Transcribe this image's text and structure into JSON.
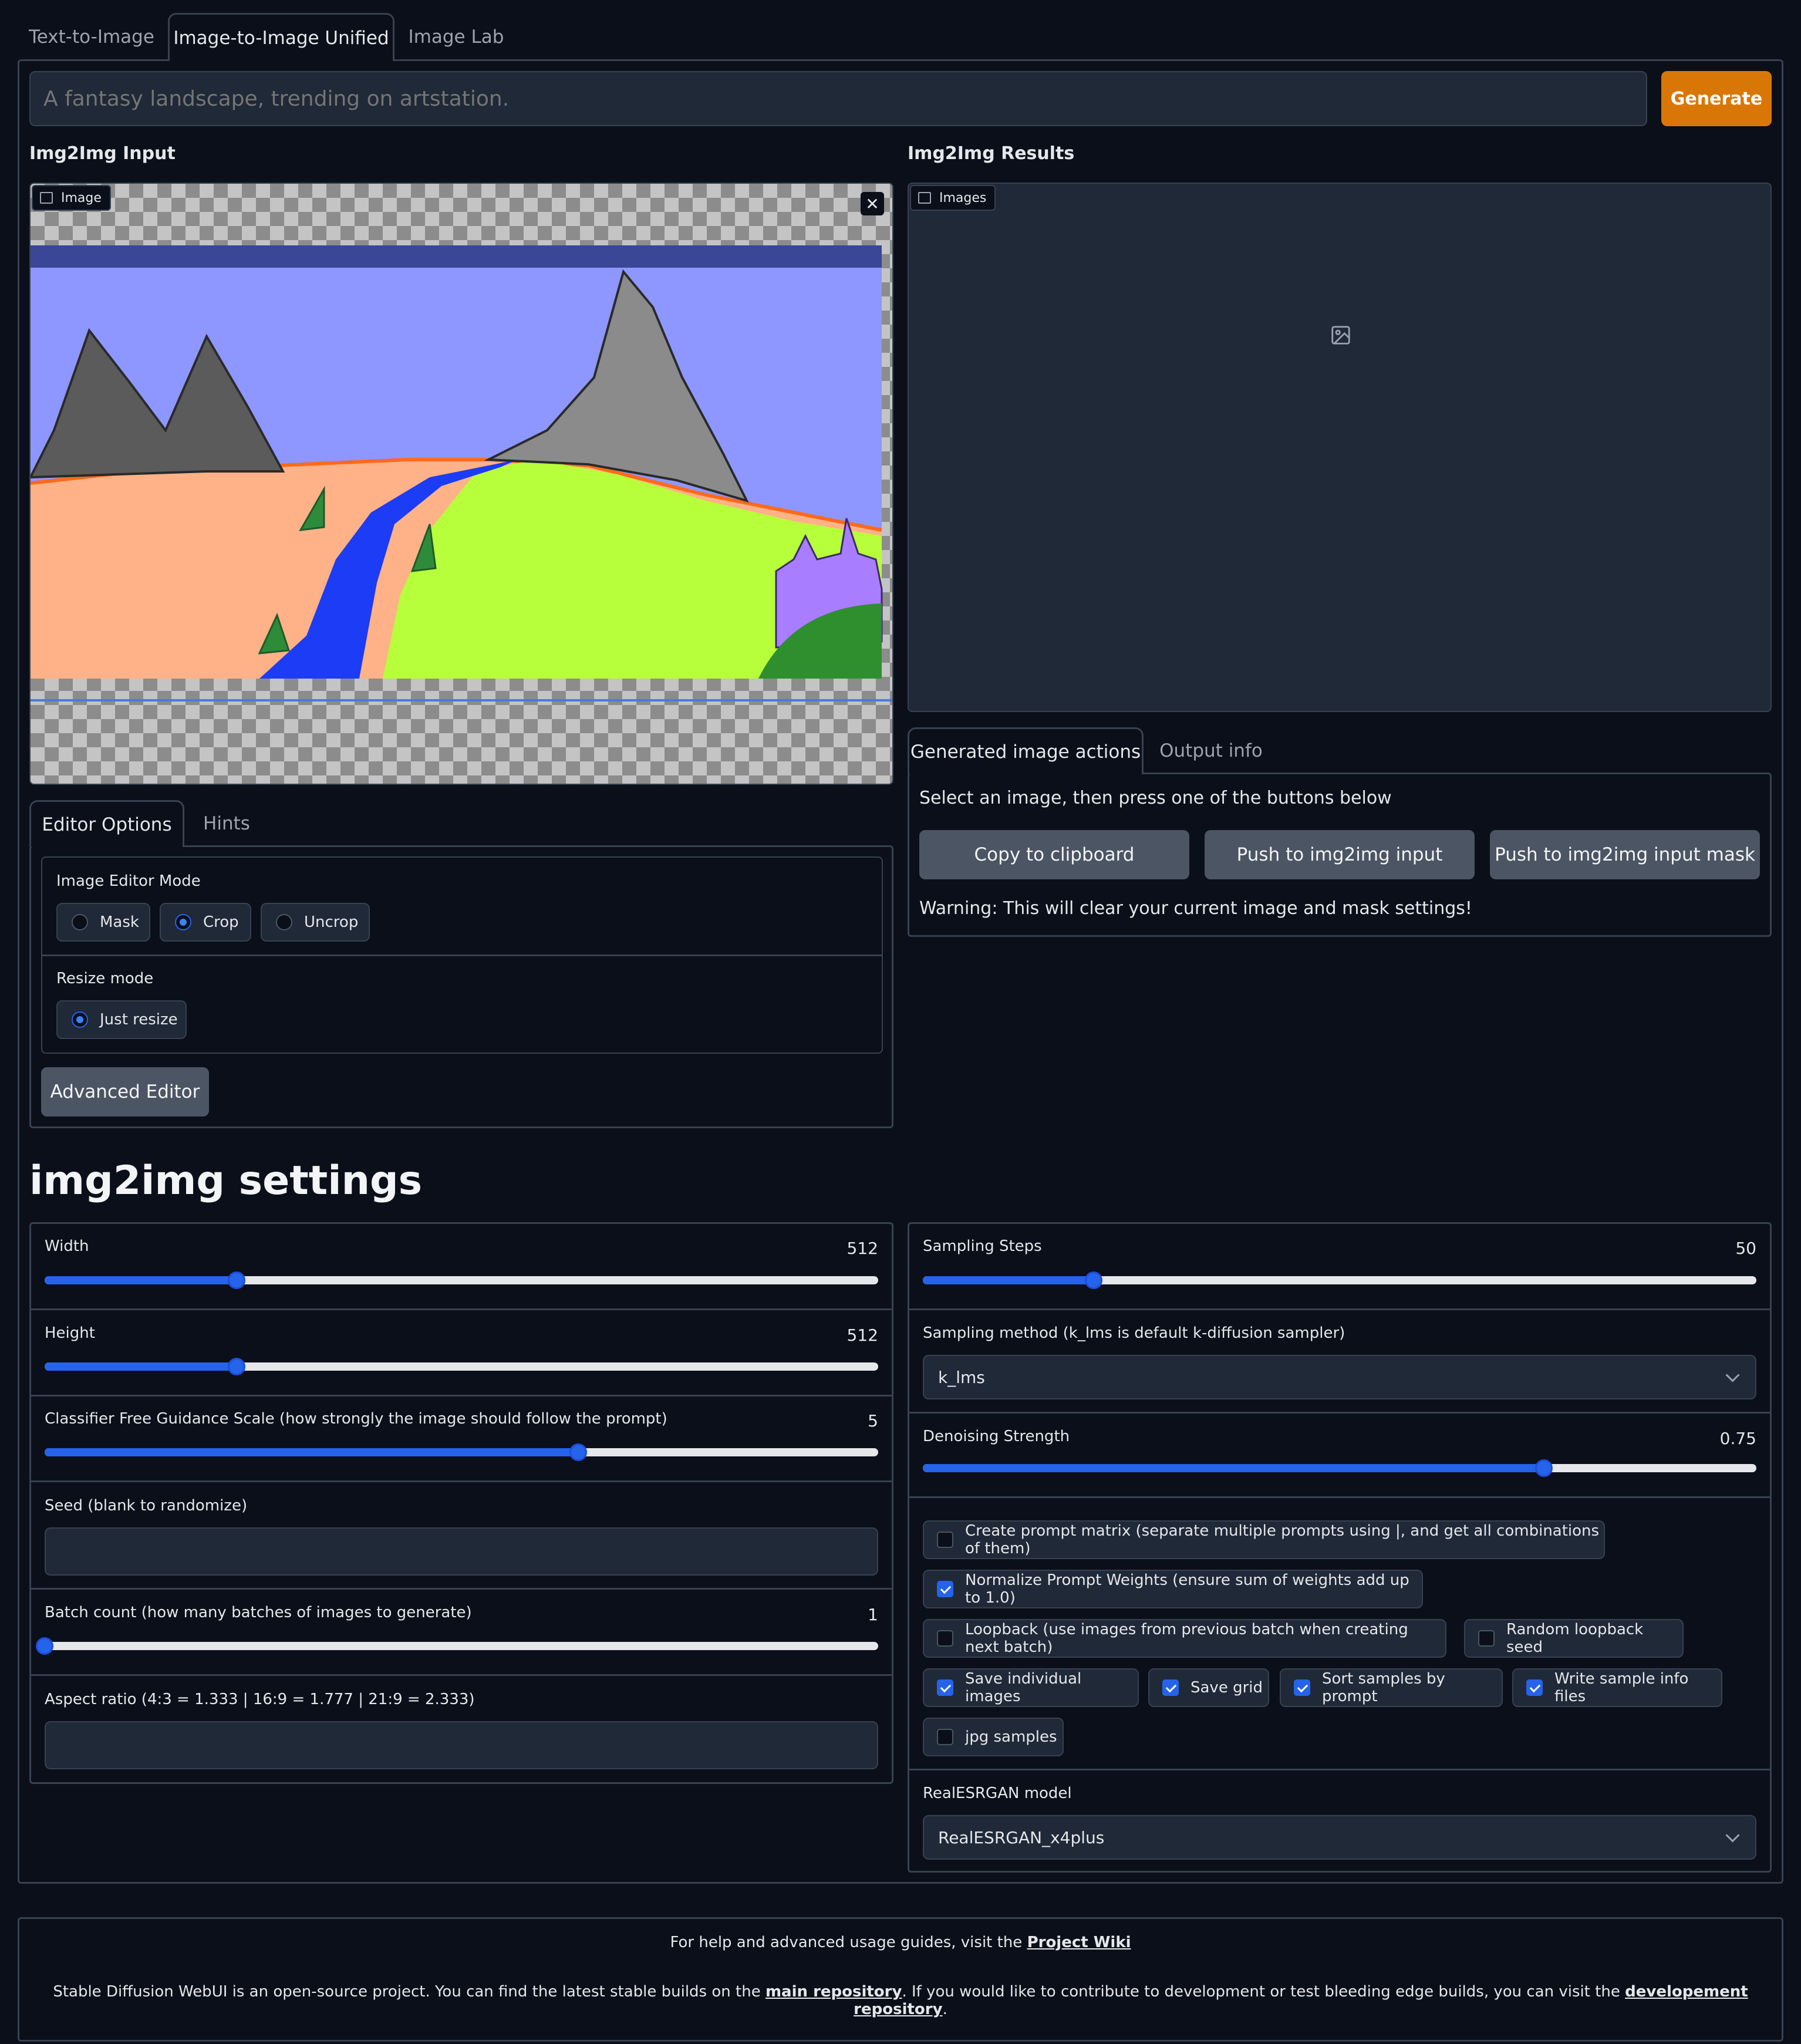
{
  "tabs": [
    {
      "label": "Text-to-Image"
    },
    {
      "label": "Image-to-Image Unified"
    },
    {
      "label": "Image Lab"
    }
  ],
  "prompt": {
    "placeholder": "A fantasy landscape, trending on artstation.",
    "value": ""
  },
  "generate_label": "Generate",
  "input_section": {
    "title": "Img2Img Input",
    "image_badge": "Image",
    "editor_tabs": [
      {
        "label": "Editor Options"
      },
      {
        "label": "Hints"
      }
    ],
    "editor_mode_label": "Image Editor Mode",
    "editor_modes": [
      {
        "label": "Mask",
        "selected": false
      },
      {
        "label": "Crop",
        "selected": true
      },
      {
        "label": "Uncrop",
        "selected": false
      }
    ],
    "resize_mode_label": "Resize mode",
    "resize_modes": [
      {
        "label": "Just resize",
        "selected": true
      }
    ],
    "advanced_editor_label": "Advanced Editor"
  },
  "results_section": {
    "title": "Img2Img Results",
    "images_badge": "Images",
    "action_tabs": [
      {
        "label": "Generated image actions"
      },
      {
        "label": "Output info"
      }
    ],
    "instruction": "Select an image, then press one of the buttons below",
    "buttons": [
      {
        "label": "Copy to clipboard"
      },
      {
        "label": "Push to img2img input"
      },
      {
        "label": "Push to img2img input mask"
      }
    ],
    "warning": "Warning: This will clear your current image and mask settings!"
  },
  "settings": {
    "title": "img2img settings",
    "width": {
      "label": "Width",
      "value": "512",
      "fraction": 0.23
    },
    "height": {
      "label": "Height",
      "value": "512",
      "fraction": 0.23
    },
    "cfg": {
      "label": "Classifier Free Guidance Scale (how strongly the image should follow the prompt)",
      "value": "5",
      "fraction": 0.64
    },
    "seed": {
      "label": "Seed (blank to randomize)",
      "value": ""
    },
    "batch_count": {
      "label": "Batch count (how many batches of images to generate)",
      "value": "1",
      "fraction": 0.0
    },
    "aspect_ratio": {
      "label": "Aspect ratio (4:3 = 1.333 | 16:9 = 1.777 | 21:9 = 2.333)",
      "value": ""
    },
    "sampling_steps": {
      "label": "Sampling Steps",
      "value": "50",
      "fraction": 0.205
    },
    "sampling_method": {
      "label": "Sampling method (k_lms is default k-diffusion sampler)",
      "value": "k_lms"
    },
    "denoising": {
      "label": "Denoising Strength",
      "value": "0.75",
      "fraction": 0.745
    },
    "checkboxes": [
      {
        "label": "Create prompt matrix (separate multiple prompts using |, and get all combinations of them)",
        "checked": false
      },
      {
        "label": "Normalize Prompt Weights (ensure sum of weights add up to 1.0)",
        "checked": true
      },
      {
        "label": "Loopback (use images from previous batch when creating next batch)",
        "checked": false
      },
      {
        "label": "Random loopback seed",
        "checked": false
      },
      {
        "label": "Save individual images",
        "checked": true
      },
      {
        "label": "Save grid",
        "checked": true
      },
      {
        "label": "Sort samples by prompt",
        "checked": true
      },
      {
        "label": "Write sample info files",
        "checked": true
      },
      {
        "label": "jpg samples",
        "checked": false
      }
    ],
    "realesrgan": {
      "label": "RealESRGAN model",
      "value": "RealESRGAN_x4plus"
    }
  },
  "footer": {
    "line1_prefix": "For help and advanced usage guides, visit the ",
    "line1_link": "Project Wiki",
    "line2_prefix": "Stable Diffusion WebUI is an open-source project. You can find the latest stable builds on the ",
    "line2_link1": "main repository",
    "line2_middle": ". If you would like to contribute to development or test bleeding edge builds, you can visit the ",
    "line2_link2": "developement repository",
    "line2_suffix": "."
  },
  "colors": {
    "accent": "#d97706",
    "slider": "#2563eb",
    "background": "#0b0f19",
    "panel_border": "#374151"
  }
}
